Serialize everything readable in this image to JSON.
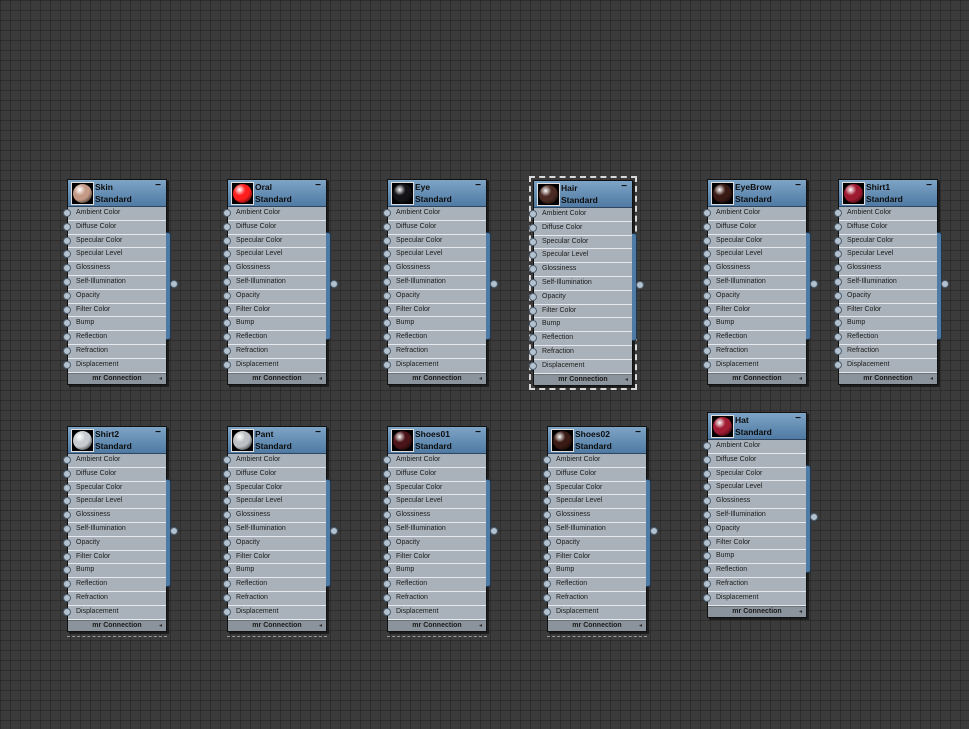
{
  "slots": [
    "Ambient Color",
    "Diffuse Color",
    "Specular Color",
    "Specular Level",
    "Glossiness",
    "Self-Illumination",
    "Opacity",
    "Filter Color",
    "Bump",
    "Reflection",
    "Refraction",
    "Displacement"
  ],
  "footer_label": "mr Connection",
  "footer_icon": "expand-arrow-icon",
  "collapse_symbol": "−",
  "nodes": [
    {
      "name": "Skin",
      "type": "Standard",
      "color": "#c49a86",
      "selected": false
    },
    {
      "name": "Oral",
      "type": "Standard",
      "color": "#ff1e1e",
      "selected": false
    },
    {
      "name": "Eye",
      "type": "Standard",
      "color": "#141418",
      "selected": false
    },
    {
      "name": "Hair",
      "type": "Standard",
      "color": "#4a2a22",
      "selected": true
    },
    {
      "name": "EyeBrow",
      "type": "Standard",
      "color": "#3a1a14",
      "selected": false
    },
    {
      "name": "Shirt1",
      "type": "Standard",
      "color": "#9e1a30",
      "selected": false
    },
    {
      "name": "Shirt2",
      "type": "Standard",
      "color": "#c8ccd0",
      "selected": false
    },
    {
      "name": "Pant",
      "type": "Standard",
      "color": "#bcc0c4",
      "selected": false
    },
    {
      "name": "Shoes01",
      "type": "Standard",
      "color": "#4a1418",
      "selected": false
    },
    {
      "name": "Shoes02",
      "type": "Standard",
      "color": "#3a1a14",
      "selected": false
    },
    {
      "name": "Hat",
      "type": "Standard",
      "color": "#a01c34",
      "selected": false
    }
  ]
}
